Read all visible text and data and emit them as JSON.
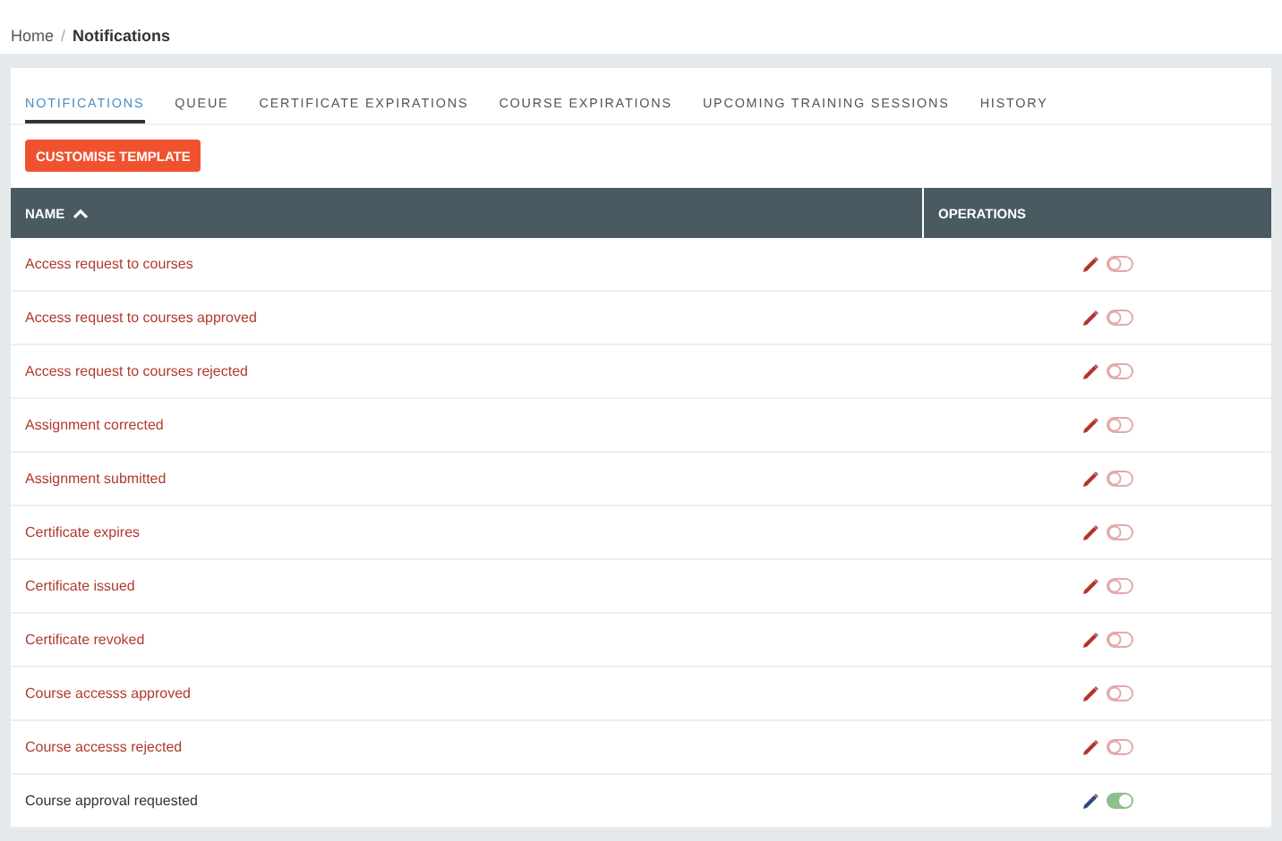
{
  "breadcrumb_separator": "/",
  "breadcrumb": [
    {
      "label": "Home",
      "current": false
    },
    {
      "label": "Notifications",
      "current": true
    }
  ],
  "tabs": [
    {
      "label": "NOTIFICATIONS",
      "selected": true
    },
    {
      "label": "QUEUE",
      "selected": false
    },
    {
      "label": "CERTIFICATE EXPIRATIONS",
      "selected": false
    },
    {
      "label": "COURSE EXPIRATIONS",
      "selected": false
    },
    {
      "label": "UPCOMING TRAINING SESSIONS",
      "selected": false
    },
    {
      "label": "HISTORY",
      "selected": false
    }
  ],
  "action_button": "CUSTOMISE TEMPLATE",
  "table": {
    "columns": [
      {
        "label": "NAME",
        "sorted": true
      },
      {
        "label": "OPERATIONS",
        "sorted": false
      }
    ],
    "rows": [
      {
        "name": "Access request to courses",
        "enabled": false
      },
      {
        "name": "Access request to courses approved",
        "enabled": false
      },
      {
        "name": "Access request to courses rejected",
        "enabled": false
      },
      {
        "name": "Assignment corrected",
        "enabled": false
      },
      {
        "name": "Assignment submitted",
        "enabled": false
      },
      {
        "name": "Certificate expires",
        "enabled": false
      },
      {
        "name": "Certificate issued",
        "enabled": false
      },
      {
        "name": "Certificate revoked",
        "enabled": false
      },
      {
        "name": "Course accesss approved",
        "enabled": false
      },
      {
        "name": "Course accesss rejected",
        "enabled": false
      },
      {
        "name": "Course approval requested",
        "enabled": true
      }
    ]
  }
}
